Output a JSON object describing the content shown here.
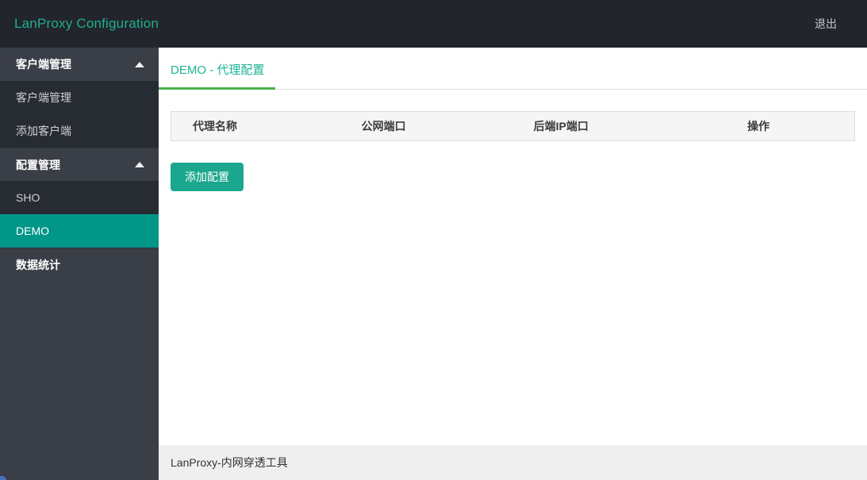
{
  "colors": {
    "topbar_bg": "#22252b",
    "brand_teal": "#1fae93",
    "sidebar_bg": "#3a3e47",
    "sidebar_submenu_bg": "#272b32",
    "active_item_bg": "#009688",
    "tab_text": "#1ab394",
    "tab_underline": "#4cae4c",
    "table_header_bg": "#f5f5f5",
    "table_border": "#dddddd",
    "add_button_bg": "#1aa78d",
    "footer_bg": "#efefef",
    "corner_accent": "#4b6fc7"
  },
  "topbar": {
    "title": "LanProxy Configuration",
    "logout_label": "退出"
  },
  "sidebar": {
    "groups": [
      {
        "label": "客户端管理",
        "items": [
          {
            "label": "客户端管理",
            "active": false
          },
          {
            "label": "添加客户端",
            "active": false
          }
        ]
      },
      {
        "label": "配置管理",
        "items": [
          {
            "label": "SHO",
            "active": false
          },
          {
            "label": "DEMO",
            "active": true
          }
        ]
      }
    ],
    "standalone_item": {
      "label": "数据统计"
    },
    "active_item": "DEMO"
  },
  "main": {
    "active_tab": "DEMO - 代理配置",
    "table": {
      "columns": [
        "代理名称",
        "公网端口",
        "后端IP端口",
        "操作"
      ],
      "rows": []
    },
    "add_config_button": "添加配置"
  },
  "footer": {
    "text": "LanProxy-内网穿透工具"
  }
}
